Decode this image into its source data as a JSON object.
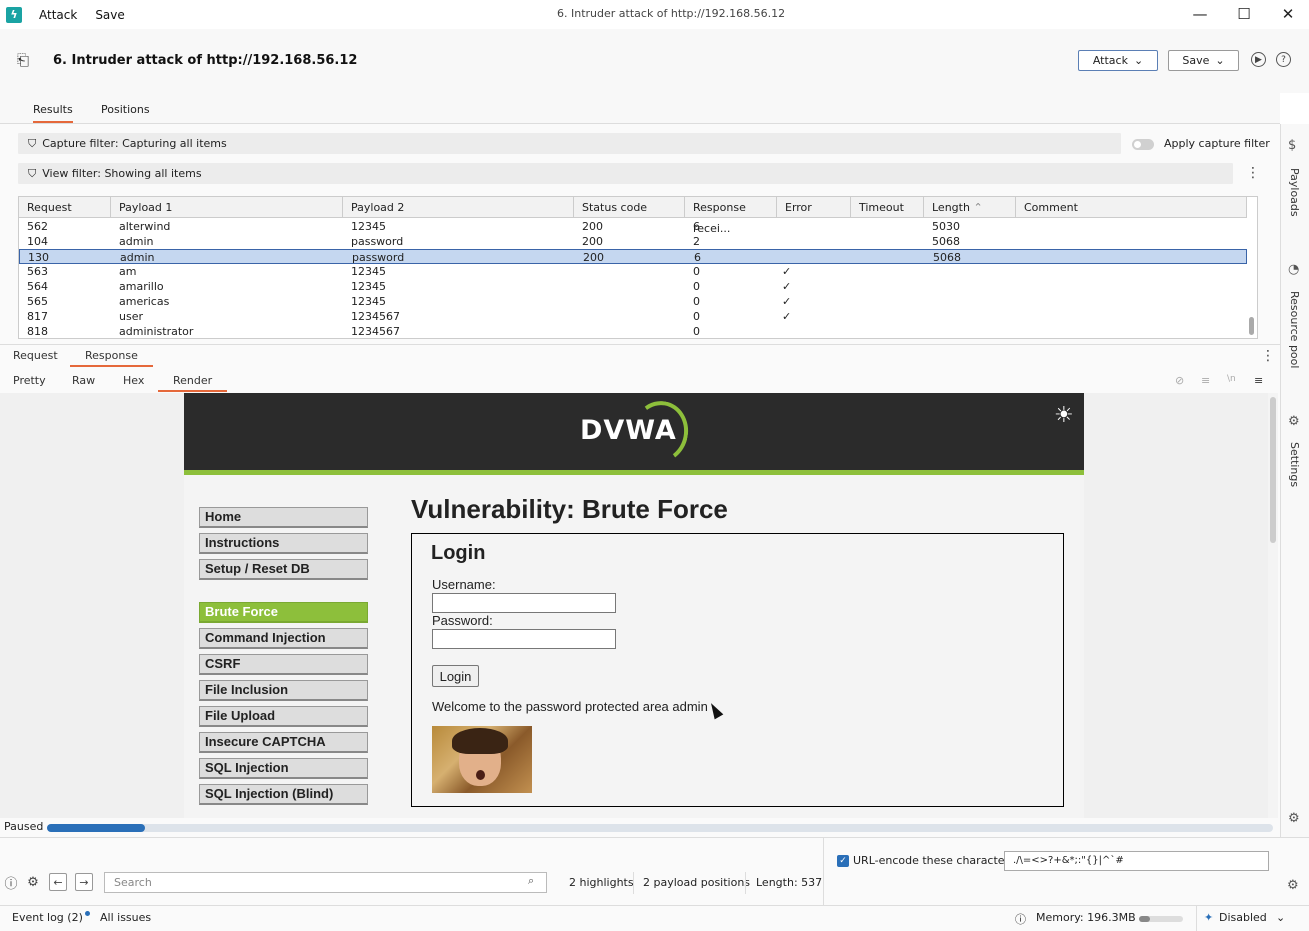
{
  "titlebar": {
    "menu": [
      "Attack",
      "Save"
    ],
    "window_title": "6. Intruder attack of http://192.168.56.12",
    "minimize": "—",
    "maximize": "☐",
    "close": "✕"
  },
  "header": {
    "title": "6. Intruder attack of http://192.168.56.12",
    "attack_label": "Attack",
    "save_label": "Save"
  },
  "tabs": [
    "Results",
    "Positions"
  ],
  "filters": {
    "capture": "Capture filter: Capturing all items",
    "apply_capture": "Apply capture filter",
    "view": "View filter: Showing all items"
  },
  "table": {
    "columns": [
      "Request",
      "Payload 1",
      "Payload 2",
      "Status code",
      "Response recei...",
      "Error",
      "Timeout",
      "Length",
      "Comment"
    ],
    "rows": [
      [
        "562",
        "alterwind",
        "12345",
        "200",
        "6",
        "",
        "",
        "5030",
        ""
      ],
      [
        "104",
        "admin",
        "password",
        "200",
        "2",
        "",
        "",
        "5068",
        ""
      ],
      [
        "130",
        "admin",
        "password",
        "200",
        "6",
        "",
        "",
        "5068",
        ""
      ],
      [
        "563",
        "am",
        "12345",
        "",
        "0",
        "✓",
        "",
        "",
        ""
      ],
      [
        "564",
        "amarillo",
        "12345",
        "",
        "0",
        "✓",
        "",
        "",
        ""
      ],
      [
        "565",
        "americas",
        "12345",
        "",
        "0",
        "✓",
        "",
        "",
        ""
      ],
      [
        "817",
        "user",
        "1234567",
        "",
        "0",
        "✓",
        "",
        "",
        ""
      ],
      [
        "818",
        "administrator",
        "1234567",
        "",
        "0",
        "",
        "",
        "",
        ""
      ]
    ],
    "selected_row": 2
  },
  "rr_tabs": [
    "Request",
    "Response"
  ],
  "view_tabs": [
    "Pretty",
    "Raw",
    "Hex",
    "Render"
  ],
  "dvwa": {
    "logo": "DVWA",
    "nav_top": [
      "Home",
      "Instructions",
      "Setup / Reset DB"
    ],
    "nav_vulns": [
      "Brute Force",
      "Command Injection",
      "CSRF",
      "File Inclusion",
      "File Upload",
      "Insecure CAPTCHA",
      "SQL Injection",
      "SQL Injection (Blind)"
    ],
    "title": "Vulnerability: Brute Force",
    "login_heading": "Login",
    "username_label": "Username:",
    "password_label": "Password:",
    "login_button": "Login",
    "welcome": "Welcome to the password protected area admin"
  },
  "status": {
    "text": "Paused",
    "progress": 0.08
  },
  "side": [
    "Payloads",
    "Resource pool",
    "Settings"
  ],
  "bottom": {
    "url_encode_label": "URL-encode these characters:",
    "url_encode_chars": "./\\=<>?+&*;:\"{}|^`#",
    "search_placeholder": "Search",
    "highlights": "2 highlights",
    "payload_positions": "2 payload positions",
    "length": "Length: 537"
  },
  "footer": {
    "event_log": "Event log (2)",
    "all_issues": "All issues",
    "memory": "Memory: 196.3MB",
    "memory_fraction": 0.25,
    "ai": "Disabled"
  }
}
